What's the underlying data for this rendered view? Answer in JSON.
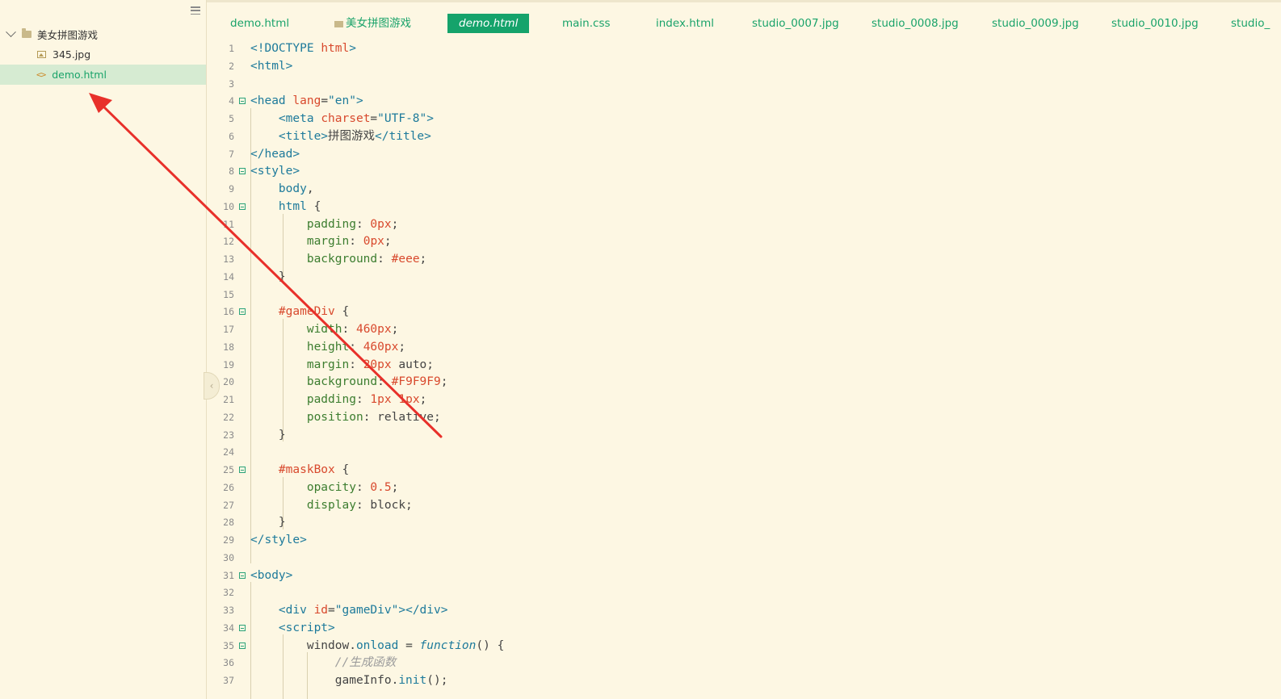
{
  "sidebar": {
    "folder": "美女拼图游戏",
    "files": [
      "345.jpg",
      "demo.html"
    ]
  },
  "tabs": [
    {
      "label": "demo.html"
    },
    {
      "label": "美女拼图游戏"
    },
    {
      "label": "demo.html"
    },
    {
      "label": "main.css"
    },
    {
      "label": "index.html"
    },
    {
      "label": "studio_0007.jpg"
    },
    {
      "label": "studio_0008.jpg"
    },
    {
      "label": "studio_0009.jpg"
    },
    {
      "label": "studio_0010.jpg"
    },
    {
      "label": "studio_"
    }
  ],
  "active_tab": 2,
  "code_lines": [
    {
      "n": "1",
      "fold": false,
      "parts": [
        [
          "t-tag",
          "<!DOCTYPE "
        ],
        [
          "t-attr",
          "html"
        ],
        [
          "t-tag",
          ">"
        ]
      ]
    },
    {
      "n": "2",
      "fold": false,
      "parts": [
        [
          "t-tag",
          "<html>"
        ]
      ]
    },
    {
      "n": "3",
      "fold": false,
      "parts": []
    },
    {
      "n": "4",
      "fold": true,
      "parts": [
        [
          "t-tag",
          "<head "
        ],
        [
          "t-attr",
          "lang"
        ],
        [
          "t-plain",
          "="
        ],
        [
          "t-str",
          "\"en\""
        ],
        [
          "t-tag",
          ">"
        ]
      ]
    },
    {
      "n": "5",
      "fold": false,
      "parts": [
        [
          "t-plain",
          "    "
        ],
        [
          "t-tag",
          "<meta "
        ],
        [
          "t-attr",
          "charset"
        ],
        [
          "t-plain",
          "="
        ],
        [
          "t-str",
          "\"UTF-8\""
        ],
        [
          "t-tag",
          ">"
        ]
      ]
    },
    {
      "n": "6",
      "fold": false,
      "parts": [
        [
          "t-plain",
          "    "
        ],
        [
          "t-tag",
          "<title>"
        ],
        [
          "t-plain",
          "拼图游戏"
        ],
        [
          "t-tag",
          "</title>"
        ]
      ]
    },
    {
      "n": "7",
      "fold": false,
      "parts": [
        [
          "t-tag",
          "</head>"
        ]
      ]
    },
    {
      "n": "8",
      "fold": true,
      "parts": [
        [
          "t-tag",
          "<style>"
        ]
      ]
    },
    {
      "n": "9",
      "fold": false,
      "parts": [
        [
          "t-plain",
          "    "
        ],
        [
          "t-tag",
          "body"
        ],
        [
          "t-plain",
          ","
        ]
      ]
    },
    {
      "n": "10",
      "fold": true,
      "parts": [
        [
          "t-plain",
          "    "
        ],
        [
          "t-tag",
          "html"
        ],
        [
          "t-plain",
          " {"
        ]
      ]
    },
    {
      "n": "11",
      "fold": false,
      "parts": [
        [
          "t-plain",
          "        "
        ],
        [
          "t-prop",
          "padding"
        ],
        [
          "t-plain",
          ": "
        ],
        [
          "t-num",
          "0"
        ],
        [
          "t-num",
          "px"
        ],
        [
          "t-plain",
          ";"
        ]
      ]
    },
    {
      "n": "12",
      "fold": false,
      "parts": [
        [
          "t-plain",
          "        "
        ],
        [
          "t-prop",
          "margin"
        ],
        [
          "t-plain",
          ": "
        ],
        [
          "t-num",
          "0"
        ],
        [
          "t-num",
          "px"
        ],
        [
          "t-plain",
          ";"
        ]
      ]
    },
    {
      "n": "13",
      "fold": false,
      "parts": [
        [
          "t-plain",
          "        "
        ],
        [
          "t-prop",
          "background"
        ],
        [
          "t-plain",
          ": "
        ],
        [
          "t-num",
          "#eee"
        ],
        [
          "t-plain",
          ";"
        ]
      ]
    },
    {
      "n": "14",
      "fold": false,
      "parts": [
        [
          "t-plain",
          "    }"
        ]
      ]
    },
    {
      "n": "15",
      "fold": false,
      "parts": []
    },
    {
      "n": "16",
      "fold": true,
      "parts": [
        [
          "t-plain",
          "    "
        ],
        [
          "t-sel",
          "#gameDiv"
        ],
        [
          "t-plain",
          " {"
        ]
      ]
    },
    {
      "n": "17",
      "fold": false,
      "parts": [
        [
          "t-plain",
          "        "
        ],
        [
          "t-prop",
          "width"
        ],
        [
          "t-plain",
          ": "
        ],
        [
          "t-num",
          "460"
        ],
        [
          "t-num",
          "px"
        ],
        [
          "t-plain",
          ";"
        ]
      ]
    },
    {
      "n": "18",
      "fold": false,
      "parts": [
        [
          "t-plain",
          "        "
        ],
        [
          "t-prop",
          "height"
        ],
        [
          "t-plain",
          ": "
        ],
        [
          "t-num",
          "460"
        ],
        [
          "t-num",
          "px"
        ],
        [
          "t-plain",
          ";"
        ]
      ]
    },
    {
      "n": "19",
      "fold": false,
      "parts": [
        [
          "t-plain",
          "        "
        ],
        [
          "t-prop",
          "margin"
        ],
        [
          "t-plain",
          ": "
        ],
        [
          "t-num",
          "20"
        ],
        [
          "t-num",
          "px"
        ],
        [
          "t-plain",
          " auto;"
        ]
      ]
    },
    {
      "n": "20",
      "fold": false,
      "parts": [
        [
          "t-plain",
          "        "
        ],
        [
          "t-prop",
          "background"
        ],
        [
          "t-plain",
          ": "
        ],
        [
          "t-num",
          "#F9F9F9"
        ],
        [
          "t-plain",
          ";"
        ]
      ]
    },
    {
      "n": "21",
      "fold": false,
      "parts": [
        [
          "t-plain",
          "        "
        ],
        [
          "t-prop",
          "padding"
        ],
        [
          "t-plain",
          ": "
        ],
        [
          "t-num",
          "1"
        ],
        [
          "t-num",
          "px"
        ],
        [
          "t-plain",
          " "
        ],
        [
          "t-num",
          "1"
        ],
        [
          "t-num",
          "px"
        ],
        [
          "t-plain",
          ";"
        ]
      ]
    },
    {
      "n": "22",
      "fold": false,
      "parts": [
        [
          "t-plain",
          "        "
        ],
        [
          "t-prop",
          "position"
        ],
        [
          "t-plain",
          ": relative;"
        ]
      ]
    },
    {
      "n": "23",
      "fold": false,
      "parts": [
        [
          "t-plain",
          "    }"
        ]
      ]
    },
    {
      "n": "24",
      "fold": false,
      "parts": []
    },
    {
      "n": "25",
      "fold": true,
      "parts": [
        [
          "t-plain",
          "    "
        ],
        [
          "t-sel",
          "#maskBox"
        ],
        [
          "t-plain",
          " {"
        ]
      ]
    },
    {
      "n": "26",
      "fold": false,
      "parts": [
        [
          "t-plain",
          "        "
        ],
        [
          "t-prop",
          "opacity"
        ],
        [
          "t-plain",
          ": "
        ],
        [
          "t-num",
          "0.5"
        ],
        [
          "t-plain",
          ";"
        ]
      ]
    },
    {
      "n": "27",
      "fold": false,
      "parts": [
        [
          "t-plain",
          "        "
        ],
        [
          "t-prop",
          "display"
        ],
        [
          "t-plain",
          ": block;"
        ]
      ]
    },
    {
      "n": "28",
      "fold": false,
      "parts": [
        [
          "t-plain",
          "    }"
        ]
      ]
    },
    {
      "n": "29",
      "fold": false,
      "parts": [
        [
          "t-tag",
          "</style>"
        ]
      ]
    },
    {
      "n": "30",
      "fold": false,
      "parts": []
    },
    {
      "n": "31",
      "fold": true,
      "parts": [
        [
          "t-tag",
          "<body>"
        ]
      ]
    },
    {
      "n": "32",
      "fold": false,
      "parts": []
    },
    {
      "n": "33",
      "fold": false,
      "parts": [
        [
          "t-plain",
          "    "
        ],
        [
          "t-tag",
          "<div "
        ],
        [
          "t-attr",
          "id"
        ],
        [
          "t-plain",
          "="
        ],
        [
          "t-str",
          "\"gameDiv\""
        ],
        [
          "t-tag",
          "></div>"
        ]
      ]
    },
    {
      "n": "34",
      "fold": true,
      "parts": [
        [
          "t-plain",
          "    "
        ],
        [
          "t-tag",
          "<script>"
        ]
      ]
    },
    {
      "n": "35",
      "fold": true,
      "parts": [
        [
          "t-plain",
          "        window."
        ],
        [
          "t-fn",
          "onload"
        ],
        [
          "t-plain",
          " = "
        ],
        [
          "t-kw",
          "function"
        ],
        [
          "t-plain",
          "() {"
        ]
      ]
    },
    {
      "n": "36",
      "fold": false,
      "parts": [
        [
          "t-plain",
          "            "
        ],
        [
          "t-cmt",
          "//生成函数"
        ]
      ]
    },
    {
      "n": "37",
      "fold": false,
      "parts": [
        [
          "t-plain",
          "            gameInfo."
        ],
        [
          "t-fn",
          "init"
        ],
        [
          "t-plain",
          "();"
        ]
      ]
    }
  ],
  "colors": {
    "accent": "#15a36b",
    "annotation_arrow": "#e8302a"
  }
}
